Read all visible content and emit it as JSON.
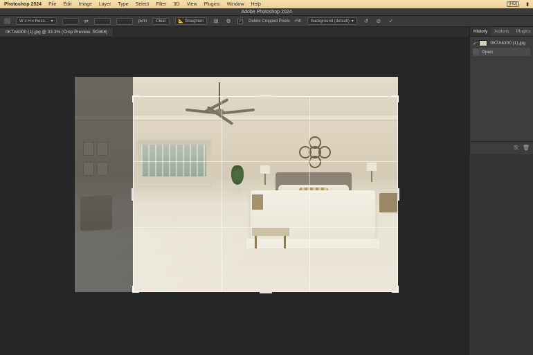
{
  "menubar": {
    "appName": "Photoshop 2024",
    "items": [
      "File",
      "Edit",
      "Image",
      "Layer",
      "Type",
      "Select",
      "Filter",
      "3D",
      "View",
      "Plugins",
      "Window",
      "Help"
    ],
    "rightBadge": "[HD]"
  },
  "titlebar": {
    "title": "Adobe Photoshop 2024"
  },
  "options": {
    "ratioDropdown": "W x H x Reso…",
    "swapLabel": "⇄",
    "resUnit": "px/in",
    "clear": "Clear",
    "straighten": "Straighten",
    "overlayIcon": "⊞",
    "gearIcon": "⚙",
    "deleteCropped": "Delete Cropped Pixels",
    "deleteCroppedChecked": true,
    "fillLabel": "Fill:",
    "fillDropdown": "Background (default)",
    "resetIcon": "↺",
    "cancelIcon": "⊘",
    "commitIcon": "✓"
  },
  "docTab": {
    "label": "0K7A6300 (1).jpg @ 33.3% (Crop Preview, RGB/8)"
  },
  "panels": {
    "tabs": [
      "History",
      "Actions",
      "Plugins"
    ],
    "activeTab": 0,
    "historyFile": "0K7A6300 (1).jpg",
    "historySteps": [
      "Open"
    ],
    "footerIcons": [
      "⎘",
      "🗑"
    ]
  }
}
